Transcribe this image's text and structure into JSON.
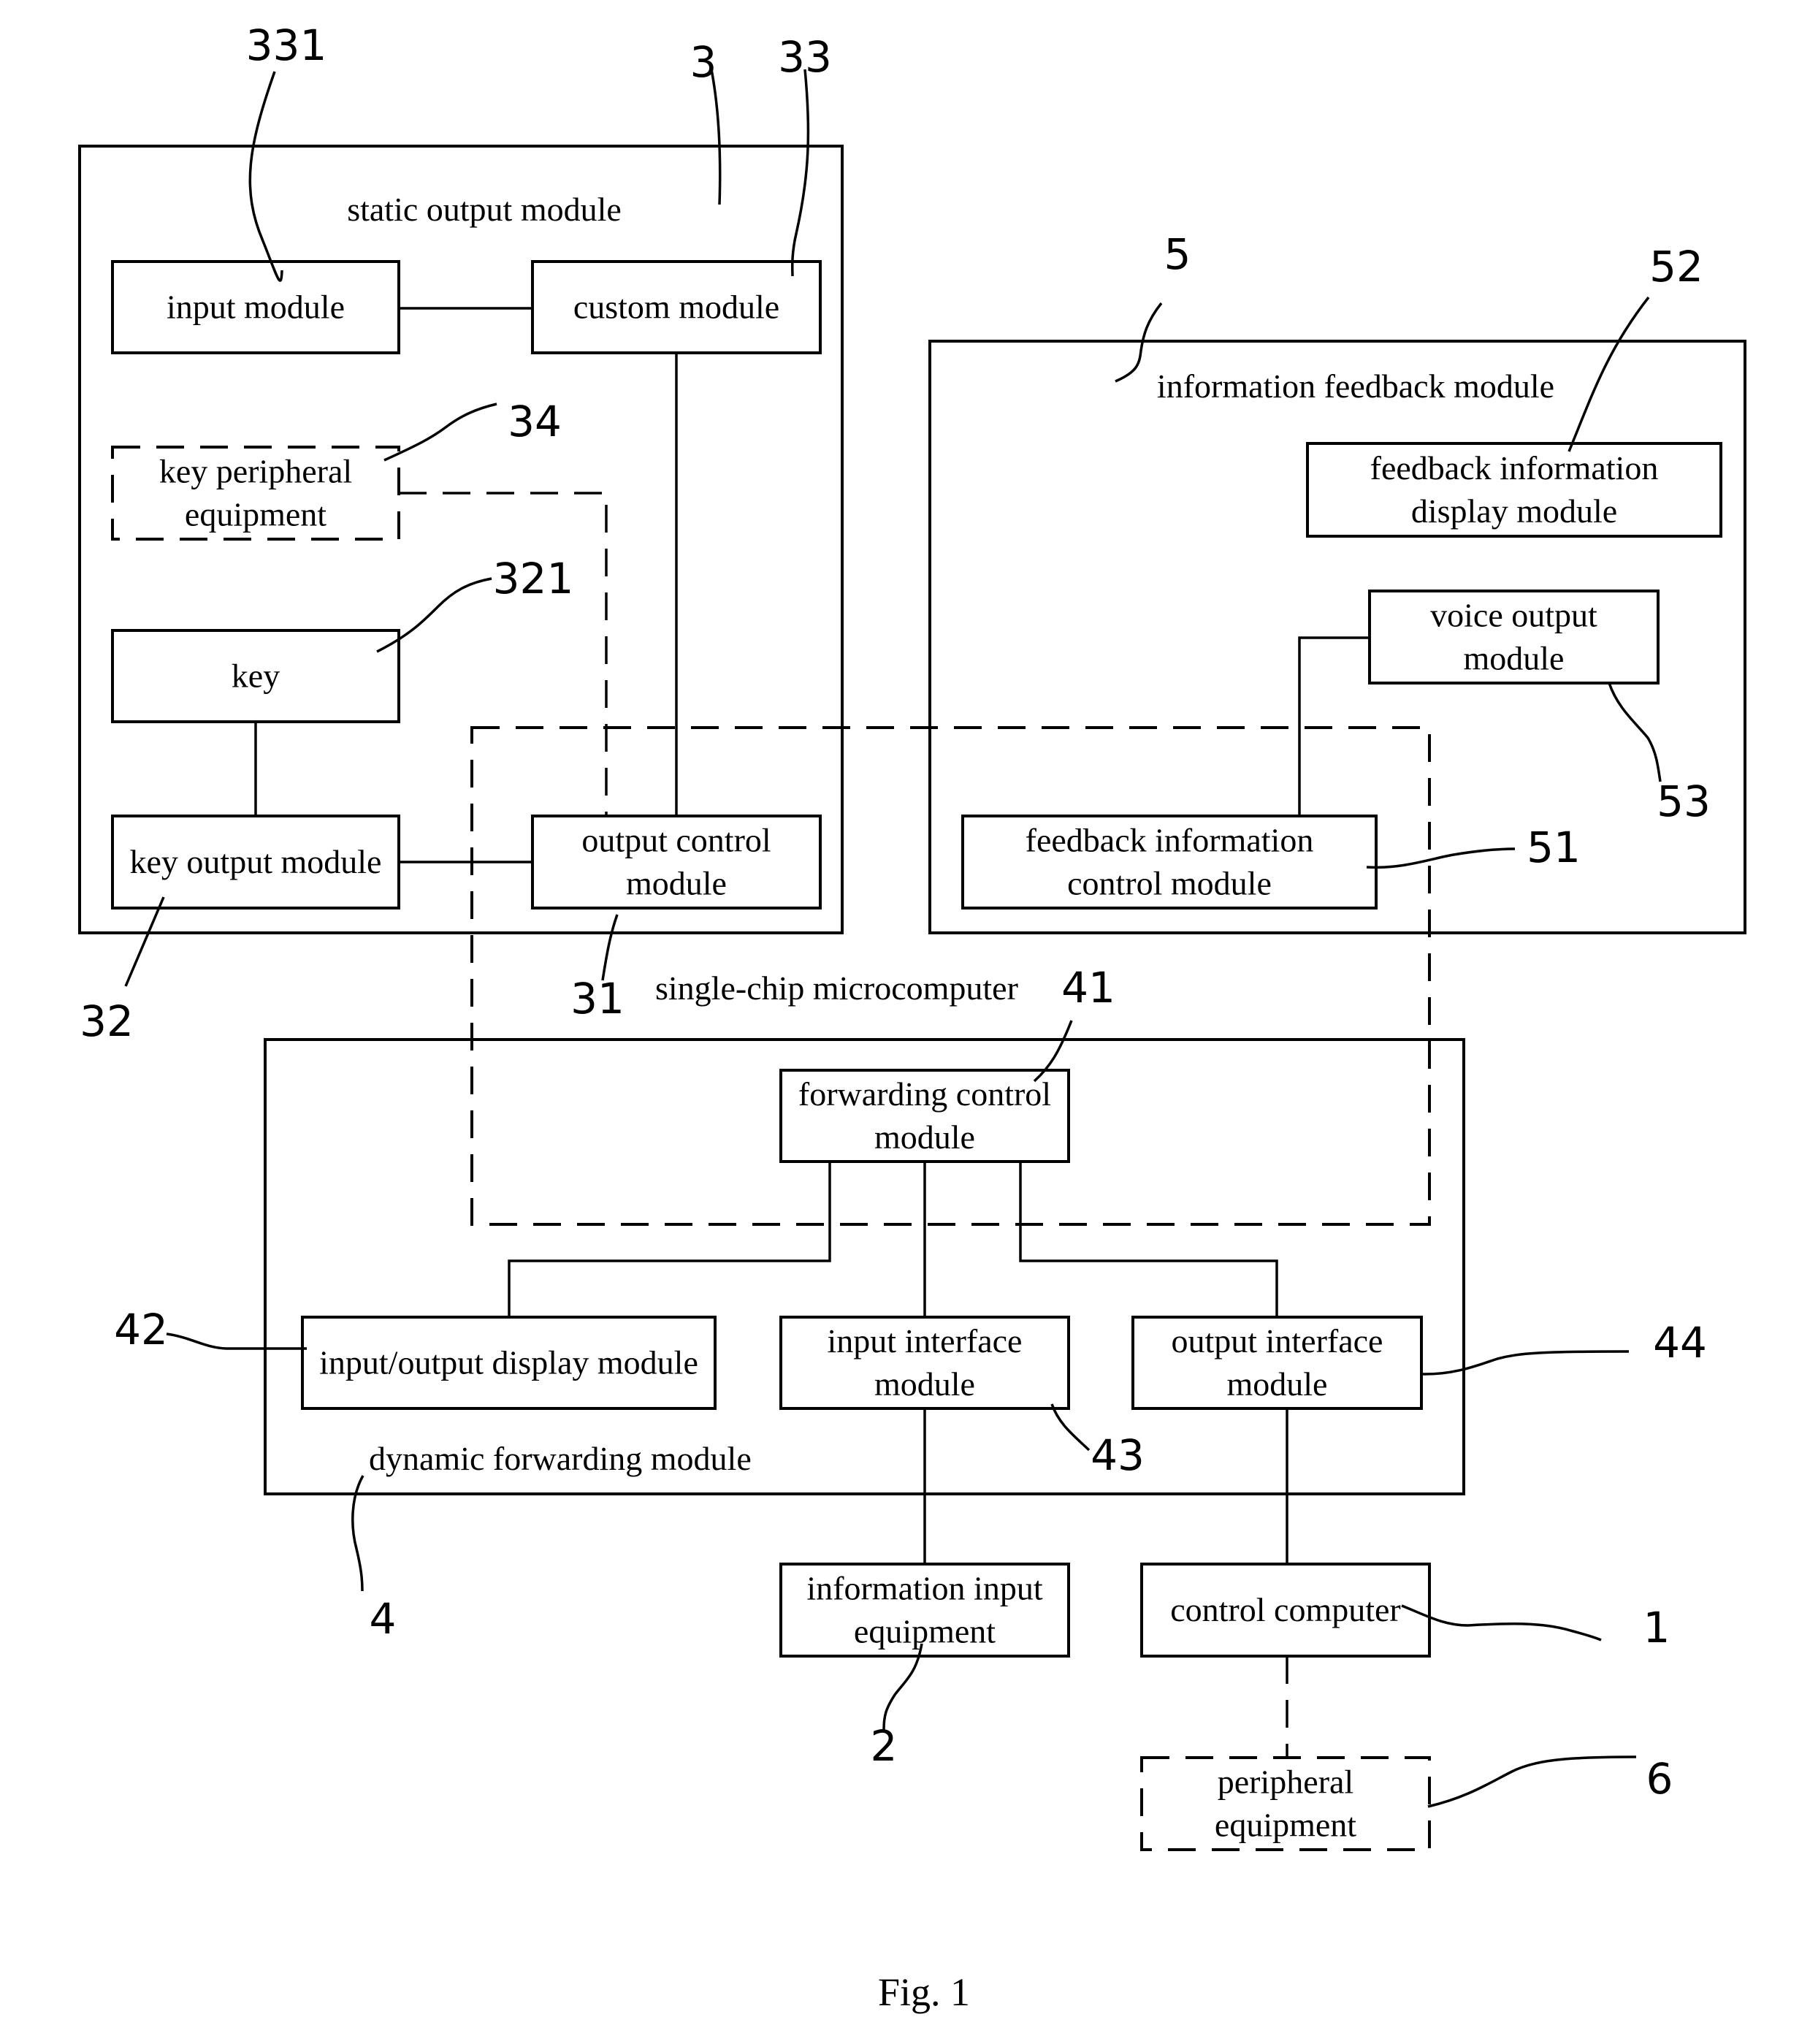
{
  "figure": {
    "caption": "Fig. 1",
    "containers": {
      "static_output": {
        "label": "static output module",
        "ref": "3"
      },
      "information_feedback": {
        "label": "information feedback module",
        "ref": "5"
      },
      "single_chip": {
        "label": "single-chip microcomputer"
      },
      "dynamic_forwarding": {
        "label": "dynamic forwarding module",
        "ref": "4"
      }
    },
    "blocks": {
      "input_module": {
        "lines": [
          "input module"
        ],
        "ref": "331"
      },
      "custom_module": {
        "lines": [
          "custom module"
        ],
        "ref": "33"
      },
      "key_peripheral": {
        "lines": [
          "key peripheral",
          "equipment"
        ],
        "ref": "34"
      },
      "key": {
        "lines": [
          "key"
        ],
        "ref": "321"
      },
      "key_output": {
        "lines": [
          "key output module"
        ],
        "ref": "32"
      },
      "output_control": {
        "lines": [
          "output control",
          "module"
        ],
        "ref": "31"
      },
      "fb_display": {
        "lines": [
          "feedback information",
          "display module"
        ],
        "ref": "52"
      },
      "voice_output": {
        "lines": [
          "voice output",
          "module"
        ],
        "ref": "53"
      },
      "fb_control": {
        "lines": [
          "feedback information",
          "control module"
        ],
        "ref": "51"
      },
      "forwarding_control": {
        "lines": [
          "forwarding control",
          "module"
        ],
        "ref": "41"
      },
      "io_display": {
        "lines": [
          "input/output display module"
        ],
        "ref": "42"
      },
      "input_interface": {
        "lines": [
          "input interface",
          "module"
        ],
        "ref": "43"
      },
      "output_interface": {
        "lines": [
          "output interface",
          "module"
        ],
        "ref": "44"
      },
      "info_input": {
        "lines": [
          "information input",
          "equipment"
        ],
        "ref": "2"
      },
      "control_computer": {
        "lines": [
          "control computer"
        ],
        "ref": "1"
      },
      "peripheral": {
        "lines": [
          "peripheral",
          "equipment"
        ],
        "ref": "6"
      }
    }
  }
}
